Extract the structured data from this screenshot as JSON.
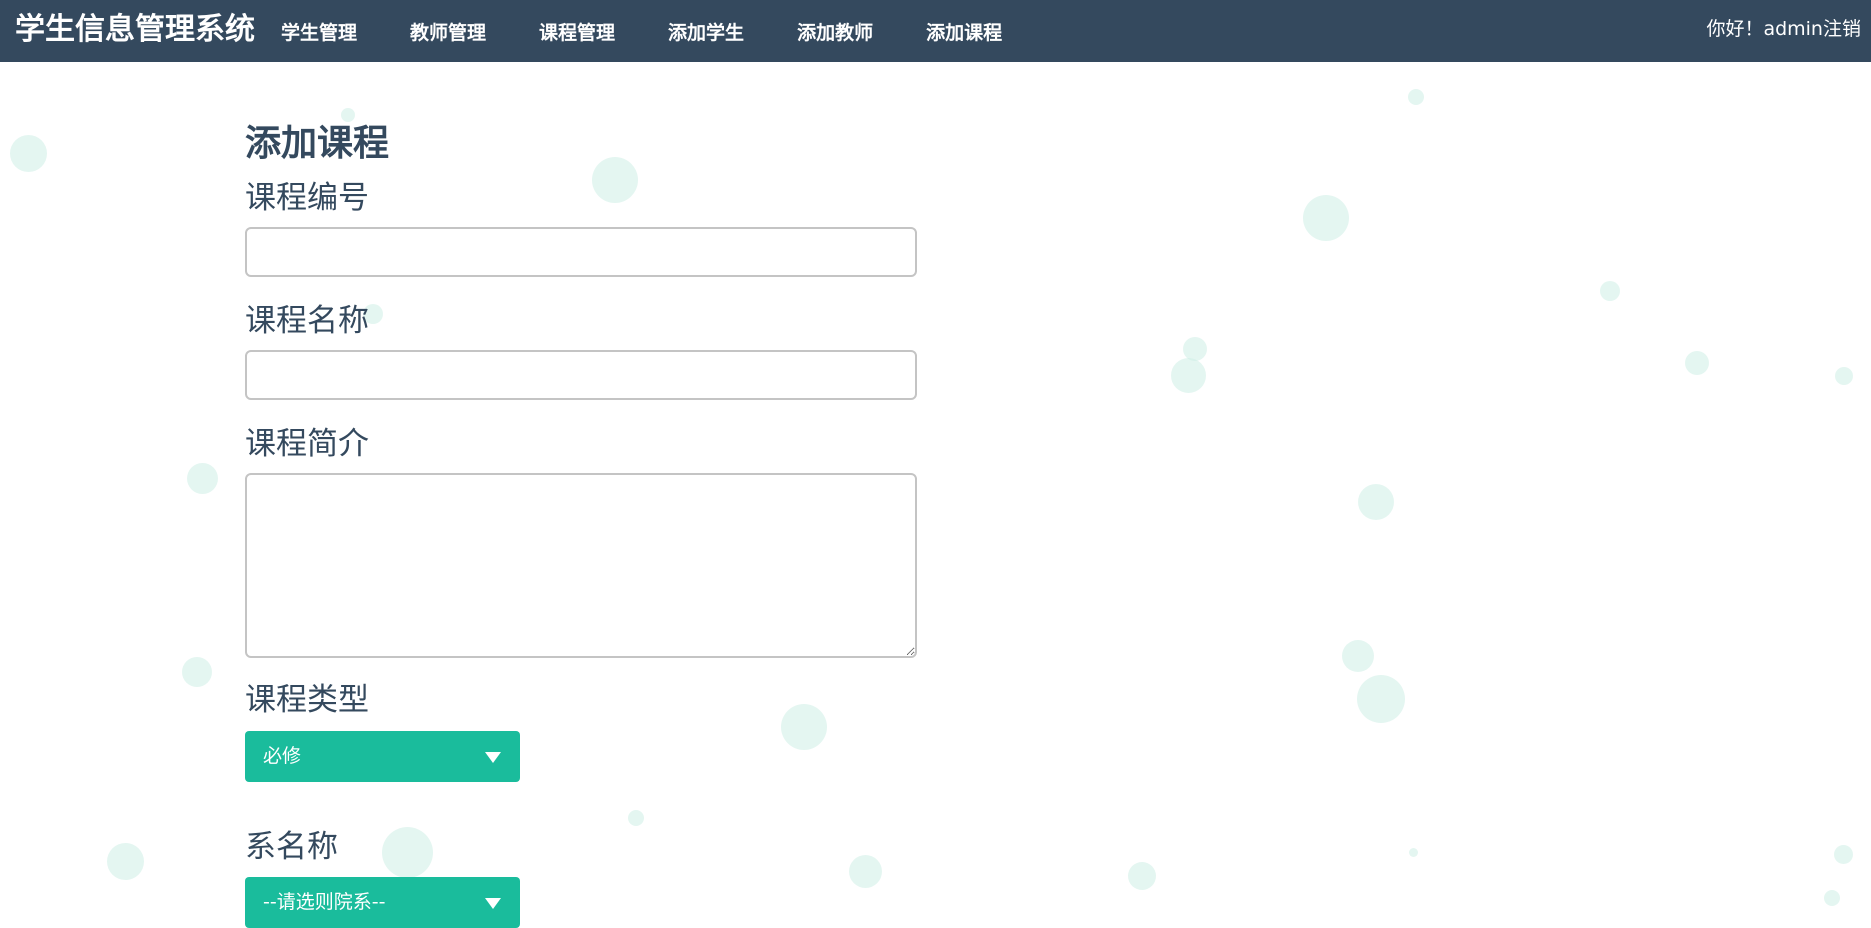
{
  "app": {
    "title": "学生信息管理系统"
  },
  "nav": {
    "items": [
      {
        "label": "学生管理"
      },
      {
        "label": "教师管理"
      },
      {
        "label": "课程管理"
      },
      {
        "label": "添加学生"
      },
      {
        "label": "添加教师"
      },
      {
        "label": "添加课程"
      }
    ]
  },
  "user": {
    "greeting": "你好！admin",
    "logout_label": "注销"
  },
  "form": {
    "title": "添加课程",
    "course_id": {
      "label": "课程编号",
      "value": "",
      "placeholder": ""
    },
    "course_name": {
      "label": "课程名称",
      "value": "",
      "placeholder": ""
    },
    "course_intro": {
      "label": "课程简介",
      "value": "",
      "placeholder": ""
    },
    "course_type": {
      "label": "课程类型",
      "selected": "必修"
    },
    "department": {
      "label": "系名称",
      "selected": "--请选则院系--"
    }
  },
  "colors": {
    "navbar": "#34495e",
    "accent": "#1abc9c",
    "text": "#34495e",
    "bubble": "#cdeee6"
  }
}
